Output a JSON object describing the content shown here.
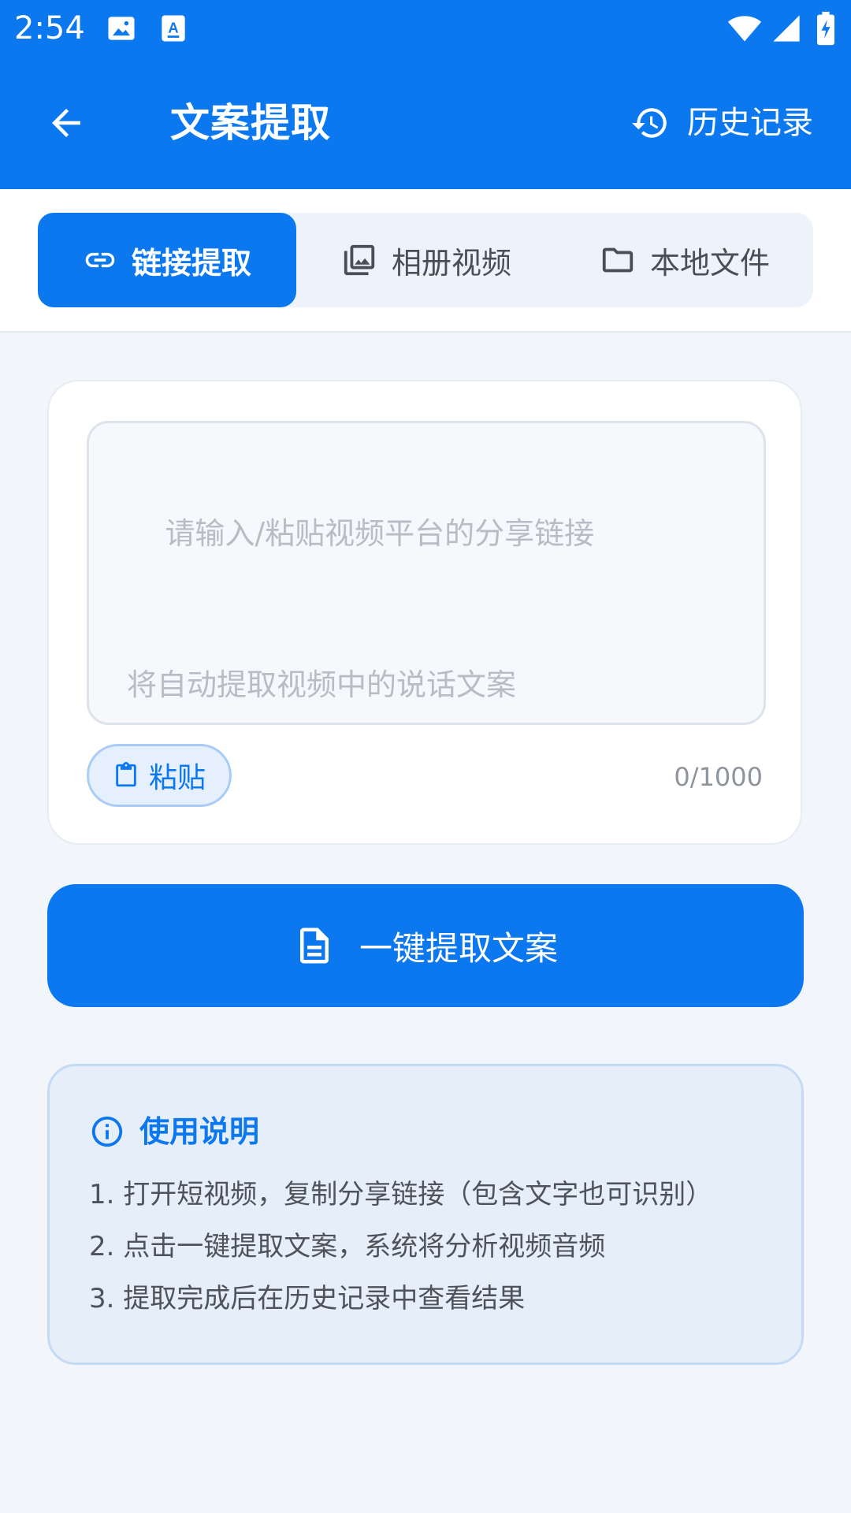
{
  "status_bar": {
    "time": "2:54",
    "icons": [
      "image-icon",
      "text-recognition-icon",
      "wifi-icon",
      "cell-signal-icon",
      "battery-charging-icon"
    ]
  },
  "app_bar": {
    "title": "文案提取",
    "back_icon": "arrow-left-icon",
    "history_icon": "history-icon",
    "history_label": "历史记录"
  },
  "tabs": [
    {
      "label": "链接提取",
      "icon": "link-icon",
      "active": true
    },
    {
      "label": "相册视频",
      "icon": "photo-library-icon",
      "active": false
    },
    {
      "label": "本地文件",
      "icon": "folder-icon",
      "active": false
    }
  ],
  "input": {
    "placeholder_line1": "请输入/粘贴视频平台的分享链接",
    "placeholder_line2": "将自动提取视频中的说话文案",
    "value": "",
    "paste_label": "粘贴",
    "counter": "0/1000"
  },
  "extract_button": {
    "label": "一键提取文案",
    "icon": "document-icon"
  },
  "instructions": {
    "title": "使用说明",
    "icon": "info-icon",
    "items": [
      "1. 打开短视频，复制分享链接（包含文字也可识别）",
      "2. 点击一键提取文案，系统将分析视频音频",
      "3. 提取完成后在历史记录中查看结果"
    ]
  },
  "colors": {
    "primary": "#0B78F0",
    "background": "#F2F5FA",
    "info_bg": "#E6EEF9"
  }
}
